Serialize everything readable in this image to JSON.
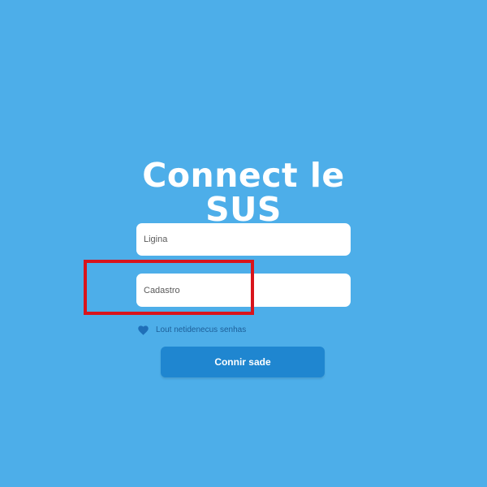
{
  "title": {
    "line1": "Connect le",
    "line2": "SUS"
  },
  "form": {
    "login_placeholder": "Ligina",
    "cadastro_placeholder": "Cadastro",
    "remember_label": "Lout netidenecus senhas",
    "remember_icon": "heart-icon",
    "submit_label": "Connir sade"
  },
  "colors": {
    "background": "#4daee9",
    "button": "#1f86d0",
    "highlight": "#d8141c"
  }
}
